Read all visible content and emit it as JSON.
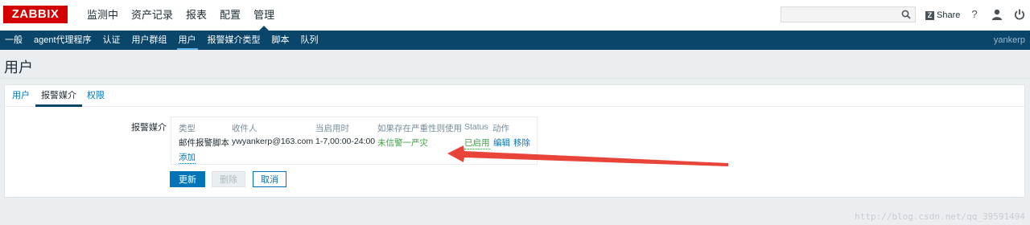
{
  "brand": {
    "logo_text": "ZABBIX",
    "color": "#d40000"
  },
  "main_nav": [
    {
      "label": "监测中"
    },
    {
      "label": "资产记录"
    },
    {
      "label": "报表"
    },
    {
      "label": "配置"
    },
    {
      "label": "管理",
      "active": true
    }
  ],
  "header_tools": {
    "search_value": "",
    "share_logo": "Z",
    "share_label": "Share",
    "help_label": "?",
    "user_icon": "user-icon",
    "logout_icon": "power-icon"
  },
  "sub_nav": {
    "items": [
      {
        "label": "一般"
      },
      {
        "label": "agent代理程序"
      },
      {
        "label": "认证"
      },
      {
        "label": "用户群组"
      },
      {
        "label": "用户",
        "active": true
      },
      {
        "label": "报警媒介类型"
      },
      {
        "label": "脚本"
      },
      {
        "label": "队列"
      }
    ],
    "username": "yankerp",
    "bg_color": "#0a466a"
  },
  "page": {
    "title": "用户"
  },
  "tabs": [
    {
      "label": "用户"
    },
    {
      "label": "报警媒介",
      "active": true
    },
    {
      "label": "权限"
    }
  ],
  "media_form": {
    "label": "报警媒介",
    "columns": {
      "type": "类型",
      "recipient": "收件人",
      "when_active": "当启用时",
      "severity": "如果存在严重性则使用",
      "status": "Status",
      "action": "动作"
    },
    "rows": [
      {
        "type": "邮件报警脚本",
        "recipient": "ywyankerp@163.com",
        "when_active": "1-7,00:00-24:00",
        "severity": "未信警一严灾",
        "status": "已启用",
        "edit": "编辑",
        "remove": "移除"
      }
    ],
    "add_label": "添加"
  },
  "buttons": {
    "update": "更新",
    "delete": "删除",
    "cancel": "取消"
  },
  "annotation": {
    "arrow_color": "#e8443a"
  },
  "watermark": "http://blog.csdn.net/qq_39591494"
}
